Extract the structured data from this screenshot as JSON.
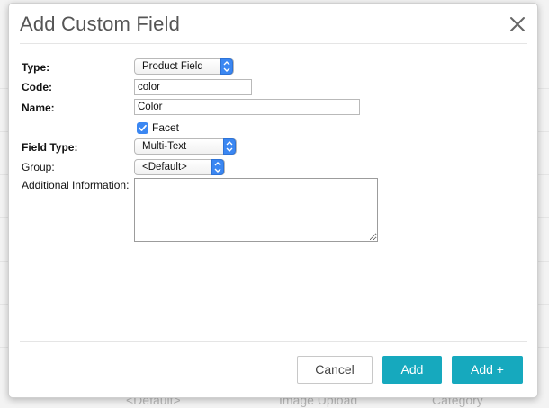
{
  "background": {
    "row_texts": [
      "<Default>",
      "Image Upload",
      "Category"
    ]
  },
  "dialog": {
    "title": "Add Custom Field",
    "close_icon": "close-icon"
  },
  "form": {
    "type": {
      "label": "Type:",
      "value": "Product Field"
    },
    "code": {
      "label": "Code:",
      "value": "color"
    },
    "name": {
      "label": "Name:",
      "value": "Color"
    },
    "facet": {
      "label": "Facet",
      "checked": true
    },
    "field_type": {
      "label": "Field Type:",
      "value": "Multi-Text"
    },
    "group": {
      "label": "Group:",
      "value": "<Default>"
    },
    "additional_information": {
      "label": "Additional Information:",
      "value": ""
    }
  },
  "footer": {
    "cancel_label": "Cancel",
    "add_label": "Add",
    "add_plus_label": "Add +"
  },
  "colors": {
    "accent": "#16a9be",
    "checkbox_blue": "#3b87f2"
  }
}
